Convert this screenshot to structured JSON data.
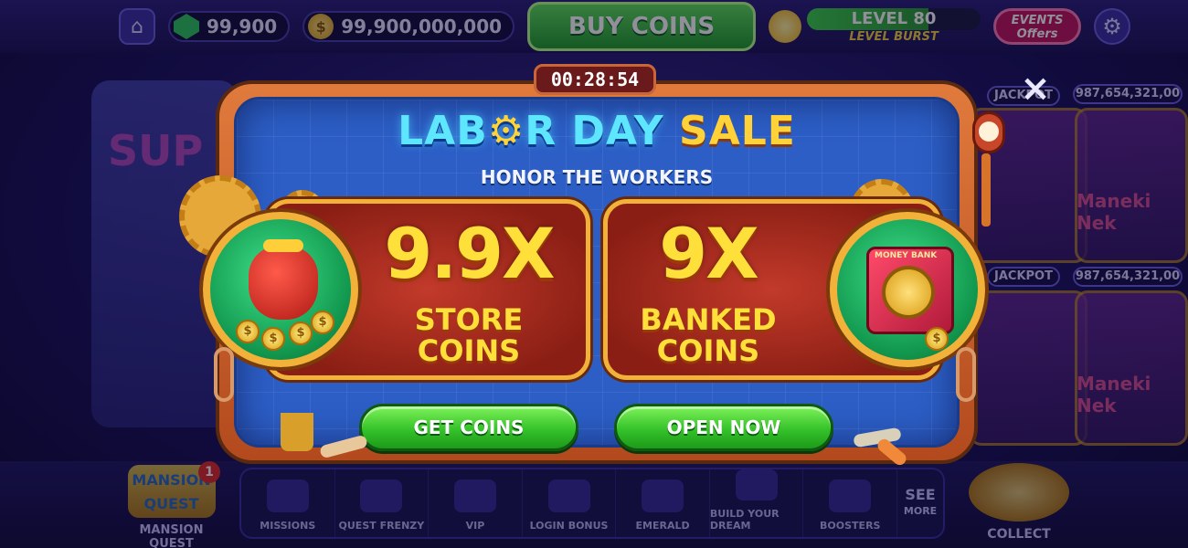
{
  "topbar": {
    "gems": "99,900",
    "coins": "99,900,000,000",
    "buy_coins_label": "BUY COINS",
    "level_label": "LEVEL 80",
    "level_sub": "LEVEL BURST",
    "events_label_1": "EVENTS",
    "events_label_2": "Offers"
  },
  "background": {
    "left_banner_text": "SUP",
    "jackpot_1": "987,654,321,00",
    "jackpot_2": "987,654,321,00",
    "slot_name": "Maneki Neko RICHES"
  },
  "popup": {
    "timer": "00:28:54",
    "close_symbol": "×",
    "title_part1": "LAB",
    "title_part2": "R DAY",
    "title_part3": "SALE",
    "subtitle": "HONOR THE WORKERS",
    "offers": [
      {
        "multiplier": "9.9X",
        "line1": "STORE",
        "line2": "COINS",
        "button": "GET COINS"
      },
      {
        "multiplier": "9X",
        "line1": "BANKED",
        "line2": "COINS",
        "button": "OPEN NOW"
      }
    ],
    "safe_label": "MONEY BANK"
  },
  "bottombar": {
    "mansion_label": "MANSION QUEST",
    "mansion_logo": "MANSION QUEST",
    "mansion_badge": "1",
    "dock": [
      {
        "label": "MISSIONS"
      },
      {
        "label": "QUEST FRENZY"
      },
      {
        "label": "VIP"
      },
      {
        "label": "LOGIN BONUS"
      },
      {
        "label": "EMERALD"
      },
      {
        "label": "BUILD YOUR DREAM"
      },
      {
        "label": "BOOSTERS"
      }
    ],
    "see_more_1": "SEE",
    "see_more_2": "MORE",
    "collect_label": "COLLECT"
  },
  "colors": {
    "board_blue": "#2c5ec6",
    "frame_orange": "#e07a3c",
    "offer_red": "#8a1e14",
    "accent_yellow": "#ffe03a",
    "button_green": "#35c22a",
    "title_cyan": "#5fe6ff"
  }
}
